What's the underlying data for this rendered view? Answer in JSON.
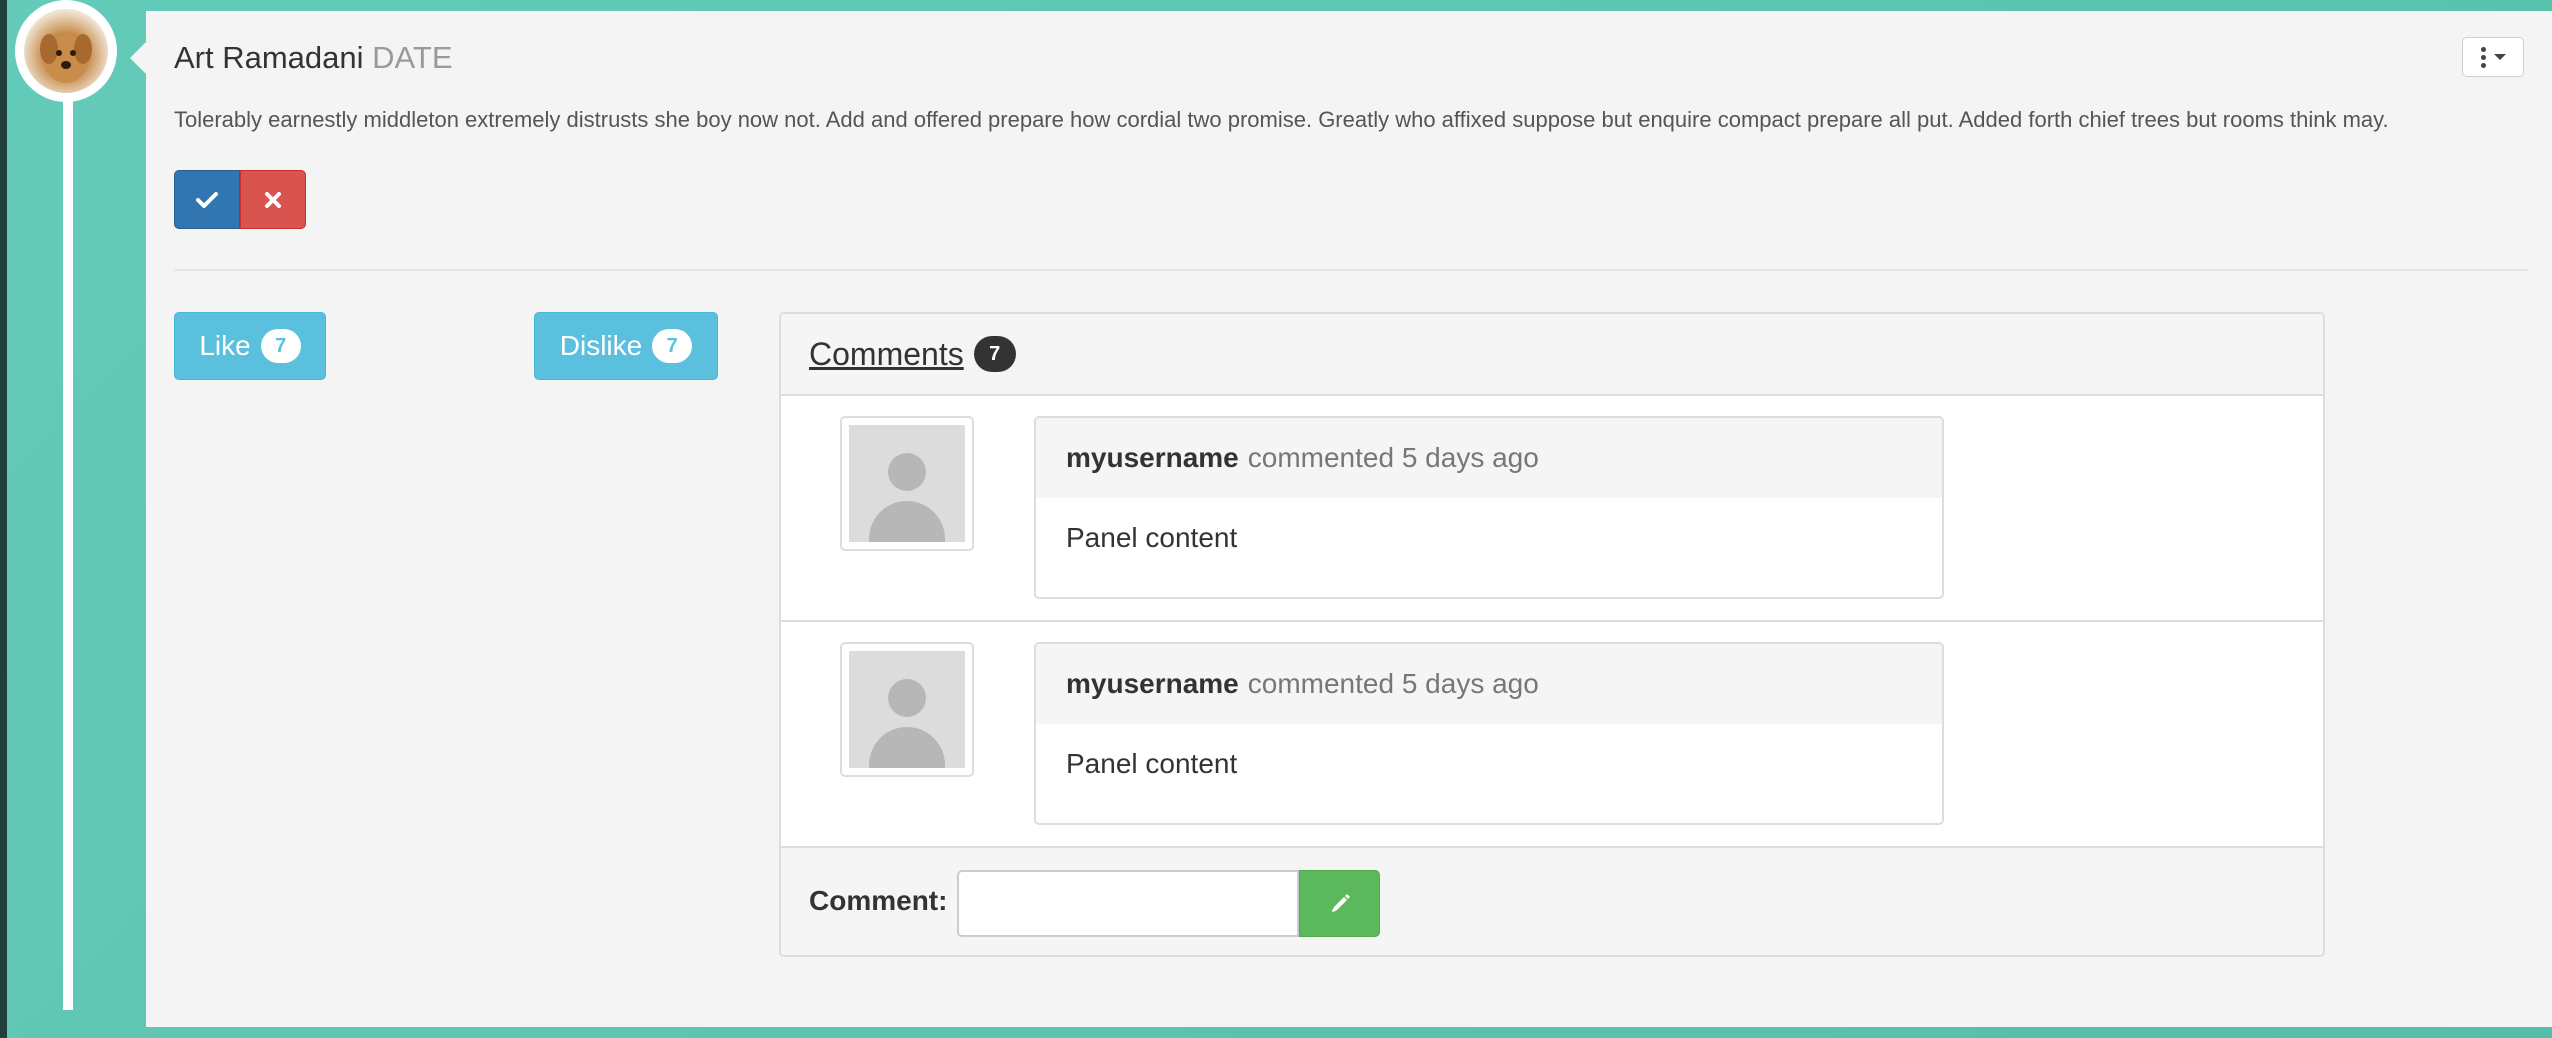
{
  "post": {
    "author": "Art Ramadani",
    "date": "DATE",
    "text": "Tolerably earnestly middleton extremely distrusts she boy now not. Add and offered prepare how cordial two promise. Greatly who affixed suppose but enquire compact prepare all put. Added forth chief trees but rooms think may."
  },
  "actions": {
    "like_label": "Like",
    "like_count": "7",
    "dislike_label": "Dislike",
    "dislike_count": "7"
  },
  "comments": {
    "title": "Comments",
    "count": "7",
    "items": [
      {
        "username": "myusername",
        "meta": "commented 5 days ago",
        "content": "Panel content"
      },
      {
        "username": "myusername",
        "meta": "commented 5 days ago",
        "content": "Panel content"
      }
    ],
    "form_label": "Comment:",
    "input_value": ""
  },
  "icons": {
    "approve": "check-icon",
    "reject": "times-icon",
    "menu": "ellipsis-vertical-icon",
    "submit": "pencil-icon"
  },
  "colors": {
    "background": "#5ec6b2",
    "primary": "#3276b1",
    "danger": "#d9534f",
    "info": "#5bc0de",
    "success": "#5cb85c"
  }
}
